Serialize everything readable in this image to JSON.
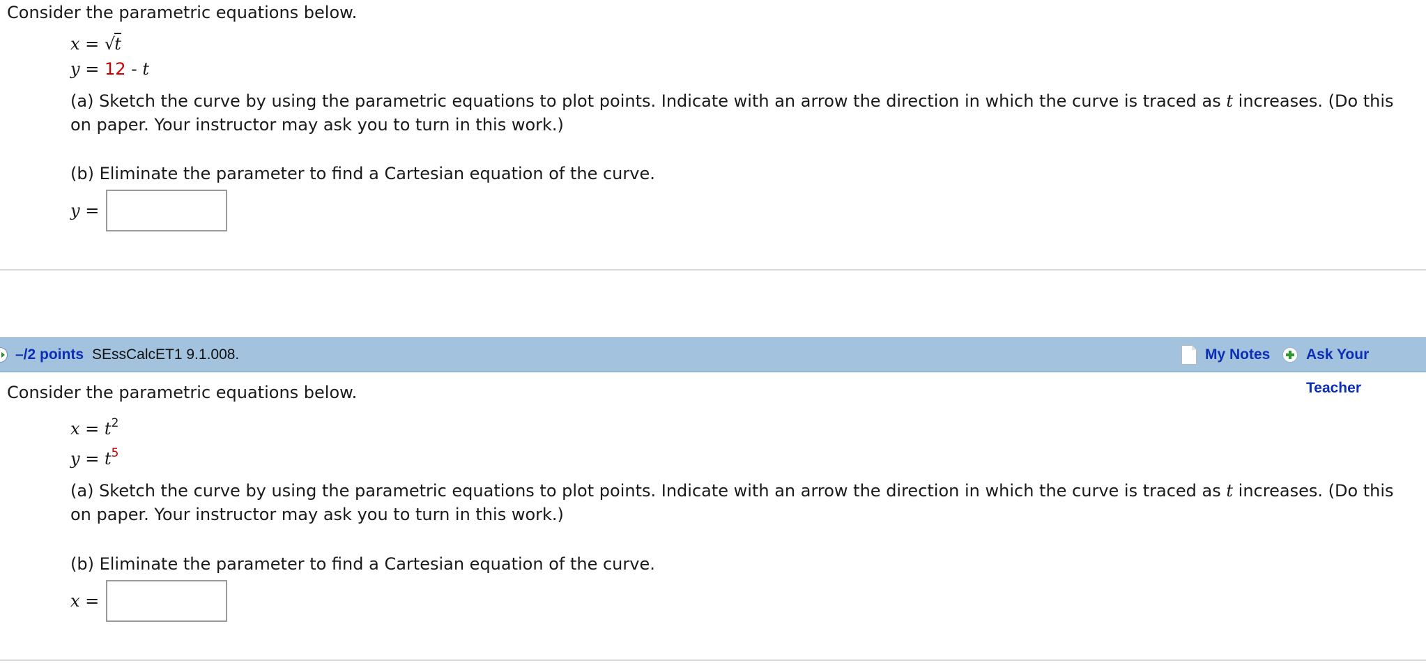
{
  "question1": {
    "intro": "Consider the parametric equations below.",
    "eq_x": {
      "lhs": "x",
      "op": " = ",
      "radical": "√",
      "radicand": "t"
    },
    "eq_y": {
      "lhs": "y",
      "op": " = ",
      "constant": "12",
      "minus": " - ",
      "var": "t"
    },
    "part_a": {
      "text_before": "(a) Sketch the curve by using the parametric equations to plot points. Indicate with an arrow the direction in which the curve is traced as ",
      "var": "t",
      "text_after": " increases. (Do this on paper. Your instructor may ask you to turn in this work.)"
    },
    "part_b": "(b) Eliminate the parameter to find a Cartesian equation of the curve.",
    "answer": {
      "var": "y",
      "op": " =",
      "value": ""
    }
  },
  "question2_header": {
    "points": "–/2 points",
    "question_id": "SEssCalcET1 9.1.008.",
    "my_notes": "My Notes",
    "ask_teacher": "Ask Your Teacher"
  },
  "question2": {
    "intro": "Consider the parametric equations below.",
    "eq_x": {
      "lhs": "x",
      "op": " = ",
      "base": "t",
      "exponent": "2"
    },
    "eq_y": {
      "lhs": "y",
      "op": " = ",
      "base": "t",
      "exponent": "5"
    },
    "part_a": {
      "text_before": "(a) Sketch the curve by using the parametric equations to plot points. Indicate with an arrow the direction in which the curve is traced as ",
      "var": "t",
      "text_after": " increases. (Do this on paper. Your instructor may ask you to turn in this work.)"
    },
    "part_b": "(b) Eliminate the parameter to find a Cartesian equation of the curve.",
    "answer": {
      "var": "x",
      "op": " =",
      "value": ""
    }
  },
  "colors": {
    "header_bar": "#a3c2dd",
    "link": "#0a2fb5",
    "highlight": "#cc0000",
    "divider": "#d9d9d9"
  },
  "icons": {
    "expand": "expand-arrow-icon",
    "notes": "note-page-icon",
    "ask": "plus-circle-icon"
  }
}
